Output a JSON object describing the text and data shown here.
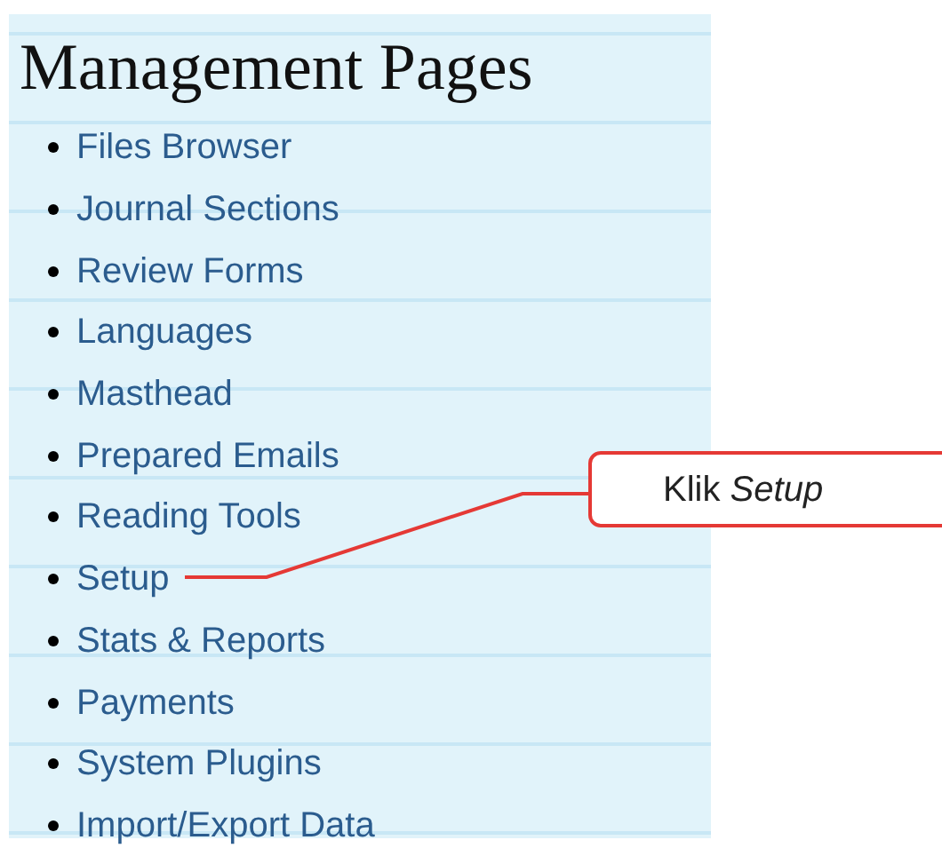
{
  "title": "Management Pages",
  "items": [
    {
      "label": "Files Browser"
    },
    {
      "label": "Journal Sections"
    },
    {
      "label": "Review Forms"
    },
    {
      "label": "Languages"
    },
    {
      "label": "Masthead"
    },
    {
      "label": "Prepared Emails"
    },
    {
      "label": "Reading Tools"
    },
    {
      "label": "Setup"
    },
    {
      "label": "Stats & Reports"
    },
    {
      "label": "Payments"
    },
    {
      "label": "System Plugins"
    },
    {
      "label": "Import/Export Data"
    }
  ],
  "callout": {
    "text": "Klik *Setup*"
  }
}
